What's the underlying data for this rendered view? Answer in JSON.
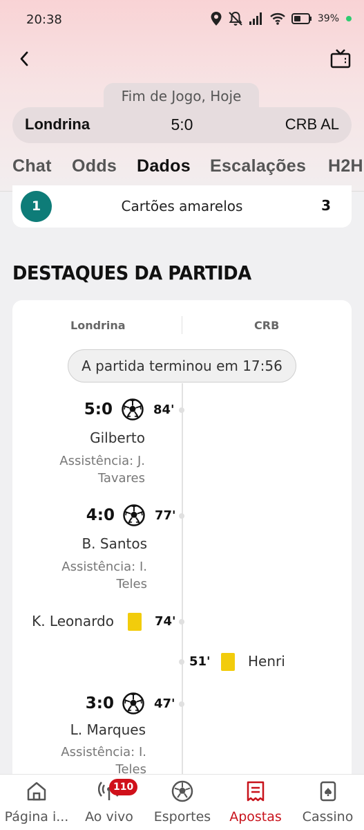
{
  "status_bar": {
    "time": "20:38",
    "battery_pct": "39%"
  },
  "header": {
    "match_status": "Fim de Jogo, Hoje"
  },
  "score_card": {
    "home": "Londrina",
    "score": "5:0",
    "away": "CRB AL"
  },
  "tabs": [
    {
      "label": "Chat"
    },
    {
      "label": "Odds"
    },
    {
      "label": "Dados",
      "active": true
    },
    {
      "label": "Escalações"
    },
    {
      "label": "H2H"
    }
  ],
  "stat_row": {
    "home_value": "1",
    "label": "Cartões amarelos",
    "away_value": "3"
  },
  "highlights": {
    "title": "DESTAQUES DA PARTIDA",
    "home_team": "Londrina",
    "away_team": "CRB",
    "match_end": "A partida terminou em 17:56",
    "events": [
      {
        "type": "goal",
        "side": "home",
        "score": "5:0",
        "minute": "84'",
        "player": "Gilberto",
        "assist_line1": "Assistência: J.",
        "assist_line2": "Tavares"
      },
      {
        "type": "goal",
        "side": "home",
        "score": "4:0",
        "minute": "77'",
        "player": "B. Santos",
        "assist_line1": "Assistência: I.",
        "assist_line2": "Teles"
      },
      {
        "type": "yellow-card",
        "side": "home",
        "minute": "74'",
        "player": "K. Leonardo"
      },
      {
        "type": "yellow-card",
        "side": "away",
        "minute": "51'",
        "player": "Henri"
      },
      {
        "type": "goal",
        "side": "home",
        "score": "3:0",
        "minute": "47'",
        "player": "L. Marques",
        "assist_line1": "Assistência: I.",
        "assist_line2": "Teles"
      }
    ]
  },
  "bottom_nav": {
    "items": [
      {
        "label": "Página i..."
      },
      {
        "label": "Ao vivo",
        "badge": "110"
      },
      {
        "label": "Esportes"
      },
      {
        "label": "Apostas",
        "active": true
      },
      {
        "label": "Cassino"
      }
    ]
  },
  "colors": {
    "accent": "#d0101a",
    "badge_teal": "#0e7c78",
    "yellow_card": "#f2cc0c"
  }
}
